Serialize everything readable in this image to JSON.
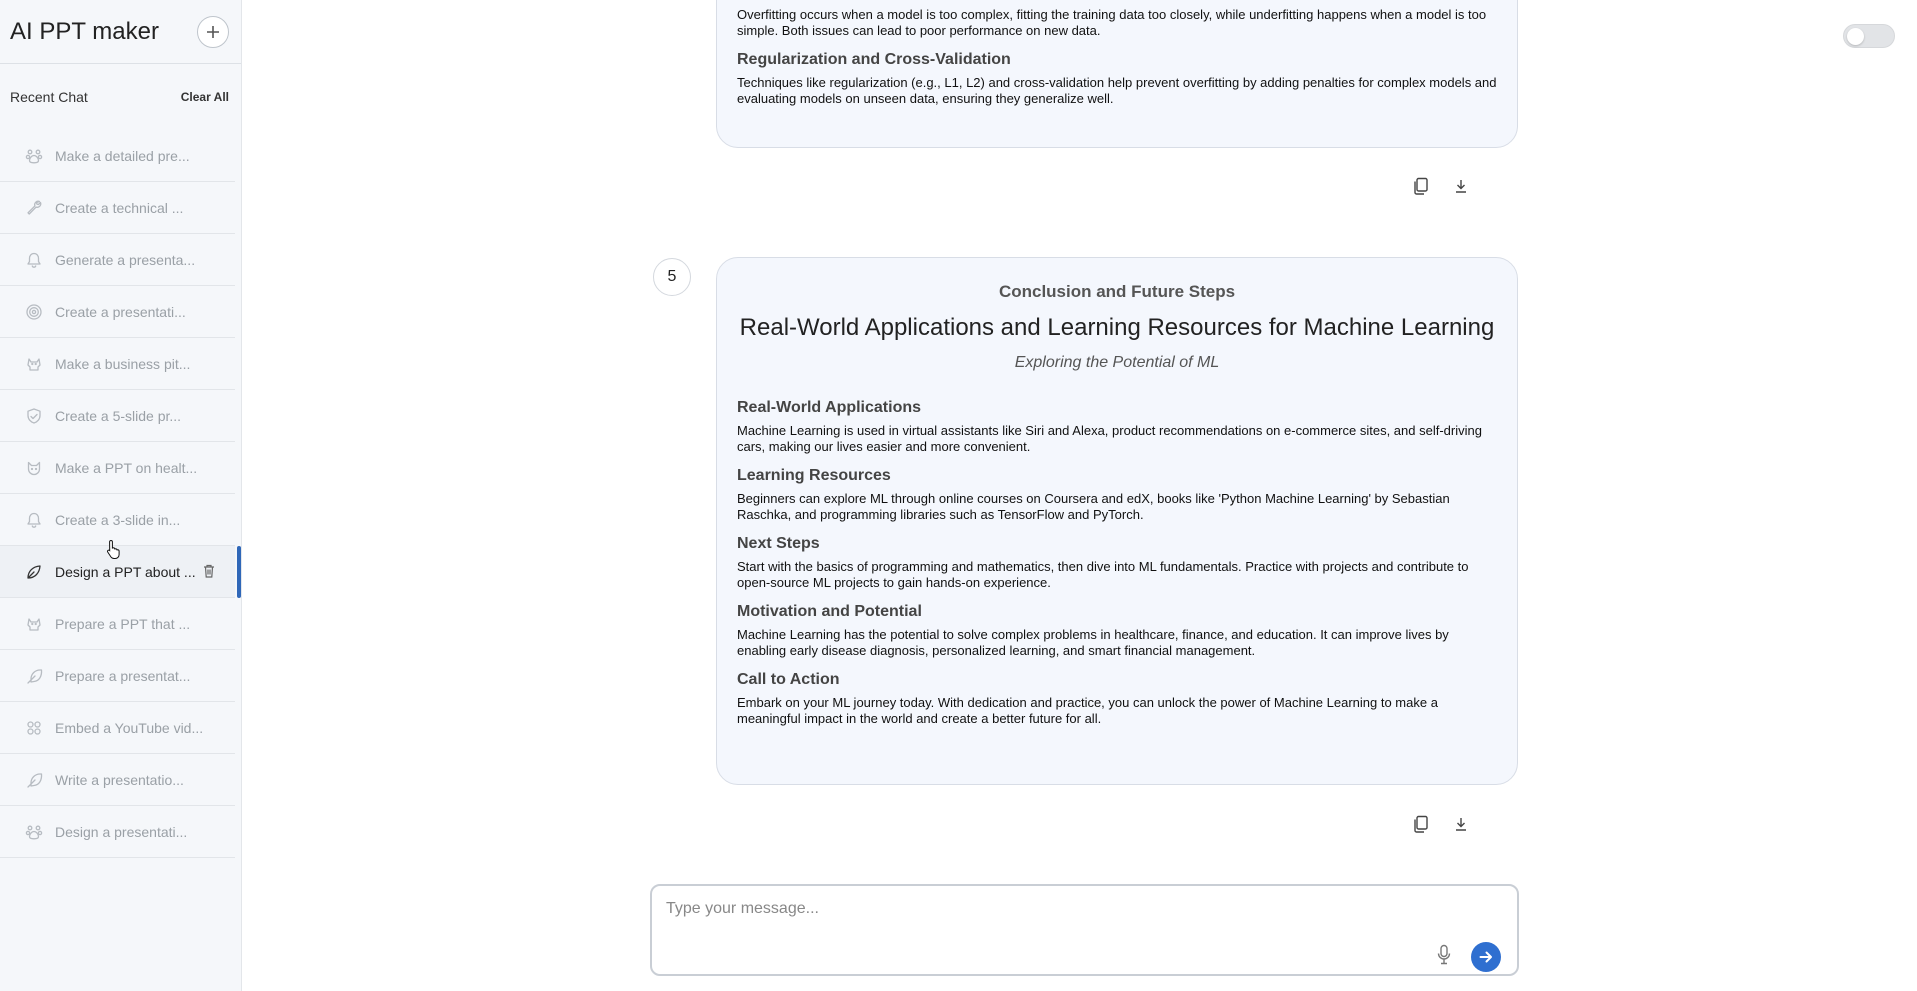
{
  "app": {
    "title": "AI PPT maker"
  },
  "sidebar": {
    "new_chat_icon": "plus-icon",
    "section_title": "Recent Chat",
    "clear_all": "Clear All",
    "items": [
      {
        "label": "Make a detailed pre...",
        "icon": "paw-icon"
      },
      {
        "label": "Create a technical ...",
        "icon": "wrench-icon"
      },
      {
        "label": "Generate a presenta...",
        "icon": "bell-icon"
      },
      {
        "label": "Create a presentati...",
        "icon": "spiral-icon"
      },
      {
        "label": "Make a business pit...",
        "icon": "dog-icon"
      },
      {
        "label": "Create a 5-slide pr...",
        "icon": "shield-icon"
      },
      {
        "label": "Make a PPT on healt...",
        "icon": "cat-icon"
      },
      {
        "label": "Create a 3-slide in...",
        "icon": "bell-icon"
      },
      {
        "label": "Design a PPT about ...",
        "icon": "leaf-icon",
        "active": true
      },
      {
        "label": "Prepare a PPT that ...",
        "icon": "dog-icon"
      },
      {
        "label": "Prepare a presentat...",
        "icon": "feather-icon"
      },
      {
        "label": "Embed a YouTube vid...",
        "icon": "grid-icon"
      },
      {
        "label": "Write a presentatio...",
        "icon": "feather-icon"
      },
      {
        "label": "Design a presentati...",
        "icon": "paw-icon"
      }
    ]
  },
  "slide_prev": {
    "sections": [
      {
        "heading": "",
        "text": "Overfitting occurs when a model is too complex, fitting the training data too closely, while underfitting happens when a model is too simple. Both issues can lead to poor performance on new data."
      },
      {
        "heading": "Regularization and Cross-Validation",
        "text": "Techniques like regularization (e.g., L1, L2) and cross-validation help prevent overfitting by adding penalties for complex models and evaluating models on unseen data, ensuring they generalize well."
      }
    ]
  },
  "slide5": {
    "number": "5",
    "section": "Conclusion and Future Steps",
    "title": "Real-World Applications and Learning Resources for Machine Learning",
    "subtitle": "Exploring the Potential of ML",
    "sections": [
      {
        "heading": "Real-World Applications",
        "text": "Machine Learning is used in virtual assistants like Siri and Alexa, product recommendations on e-commerce sites, and self-driving cars, making our lives easier and more convenient."
      },
      {
        "heading": "Learning Resources",
        "text": "Beginners can explore ML through online courses on Coursera and edX, books like 'Python Machine Learning' by Sebastian Raschka, and programming libraries such as TensorFlow and PyTorch."
      },
      {
        "heading": "Next Steps",
        "text": "Start with the basics of programming and mathematics, then dive into ML fundamentals. Practice with projects and contribute to open-source ML projects to gain hands-on experience."
      },
      {
        "heading": "Motivation and Potential",
        "text": "Machine Learning has the potential to solve complex problems in healthcare, finance, and education. It can improve lives by enabling early disease diagnosis, personalized learning, and smart financial management."
      },
      {
        "heading": "Call to Action",
        "text": "Embark on your ML journey today. With dedication and practice, you can unlock the power of Machine Learning to make a meaningful impact in the world and create a better future for all."
      }
    ]
  },
  "composer": {
    "placeholder": "Type your message..."
  },
  "colors": {
    "accent": "#2f6fd0",
    "active_bar": "#2f67b8",
    "card_bg": "#f4f7fd"
  }
}
